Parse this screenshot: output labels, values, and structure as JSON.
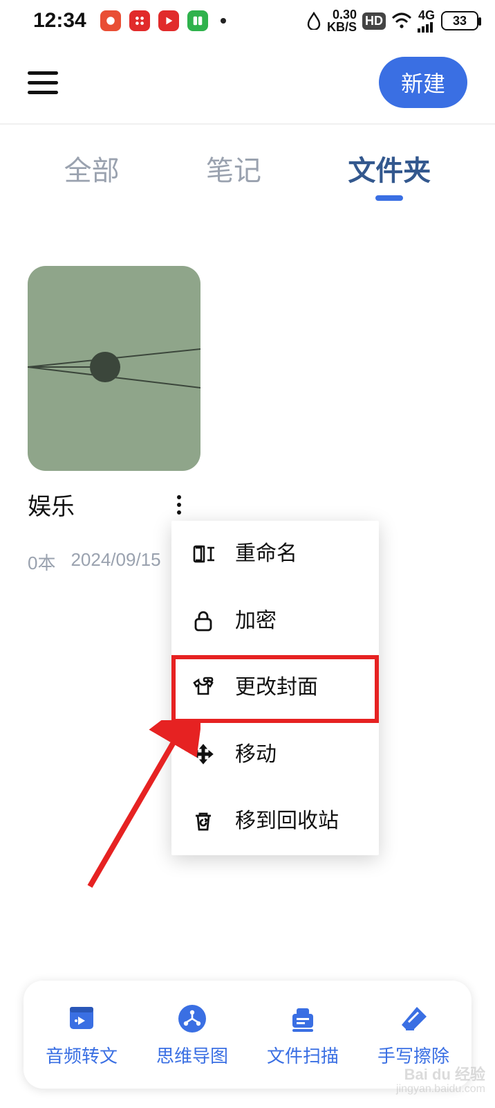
{
  "status": {
    "time": "12:34",
    "net_speed_top": "0.30",
    "net_speed_bottom": "KB/S",
    "hd": "HD",
    "net_type": "4G",
    "battery": "33"
  },
  "header": {
    "new_button": "新建"
  },
  "tabs": {
    "items": [
      {
        "label": "全部",
        "active": false
      },
      {
        "label": "笔记",
        "active": false
      },
      {
        "label": "文件夹",
        "active": true
      }
    ]
  },
  "folder": {
    "title": "娱乐",
    "count": "0本",
    "date": "2024/09/15"
  },
  "context_menu": {
    "items": [
      {
        "label": "重命名",
        "icon": "rename-icon"
      },
      {
        "label": "加密",
        "icon": "lock-icon"
      },
      {
        "label": "更改封面",
        "icon": "shirt-icon",
        "highlighted": true
      },
      {
        "label": "移动",
        "icon": "move-icon"
      },
      {
        "label": "移到回收站",
        "icon": "trash-icon"
      }
    ]
  },
  "bottom_bar": {
    "items": [
      {
        "label": "音频转文",
        "icon": "audio-icon"
      },
      {
        "label": "思维导图",
        "icon": "mindmap-icon"
      },
      {
        "label": "文件扫描",
        "icon": "scan-icon"
      },
      {
        "label": "手写擦除",
        "icon": "eraser-icon"
      }
    ]
  },
  "watermark": {
    "line1": "Bai du 经验",
    "line2": "jingyan.baidu.com"
  }
}
